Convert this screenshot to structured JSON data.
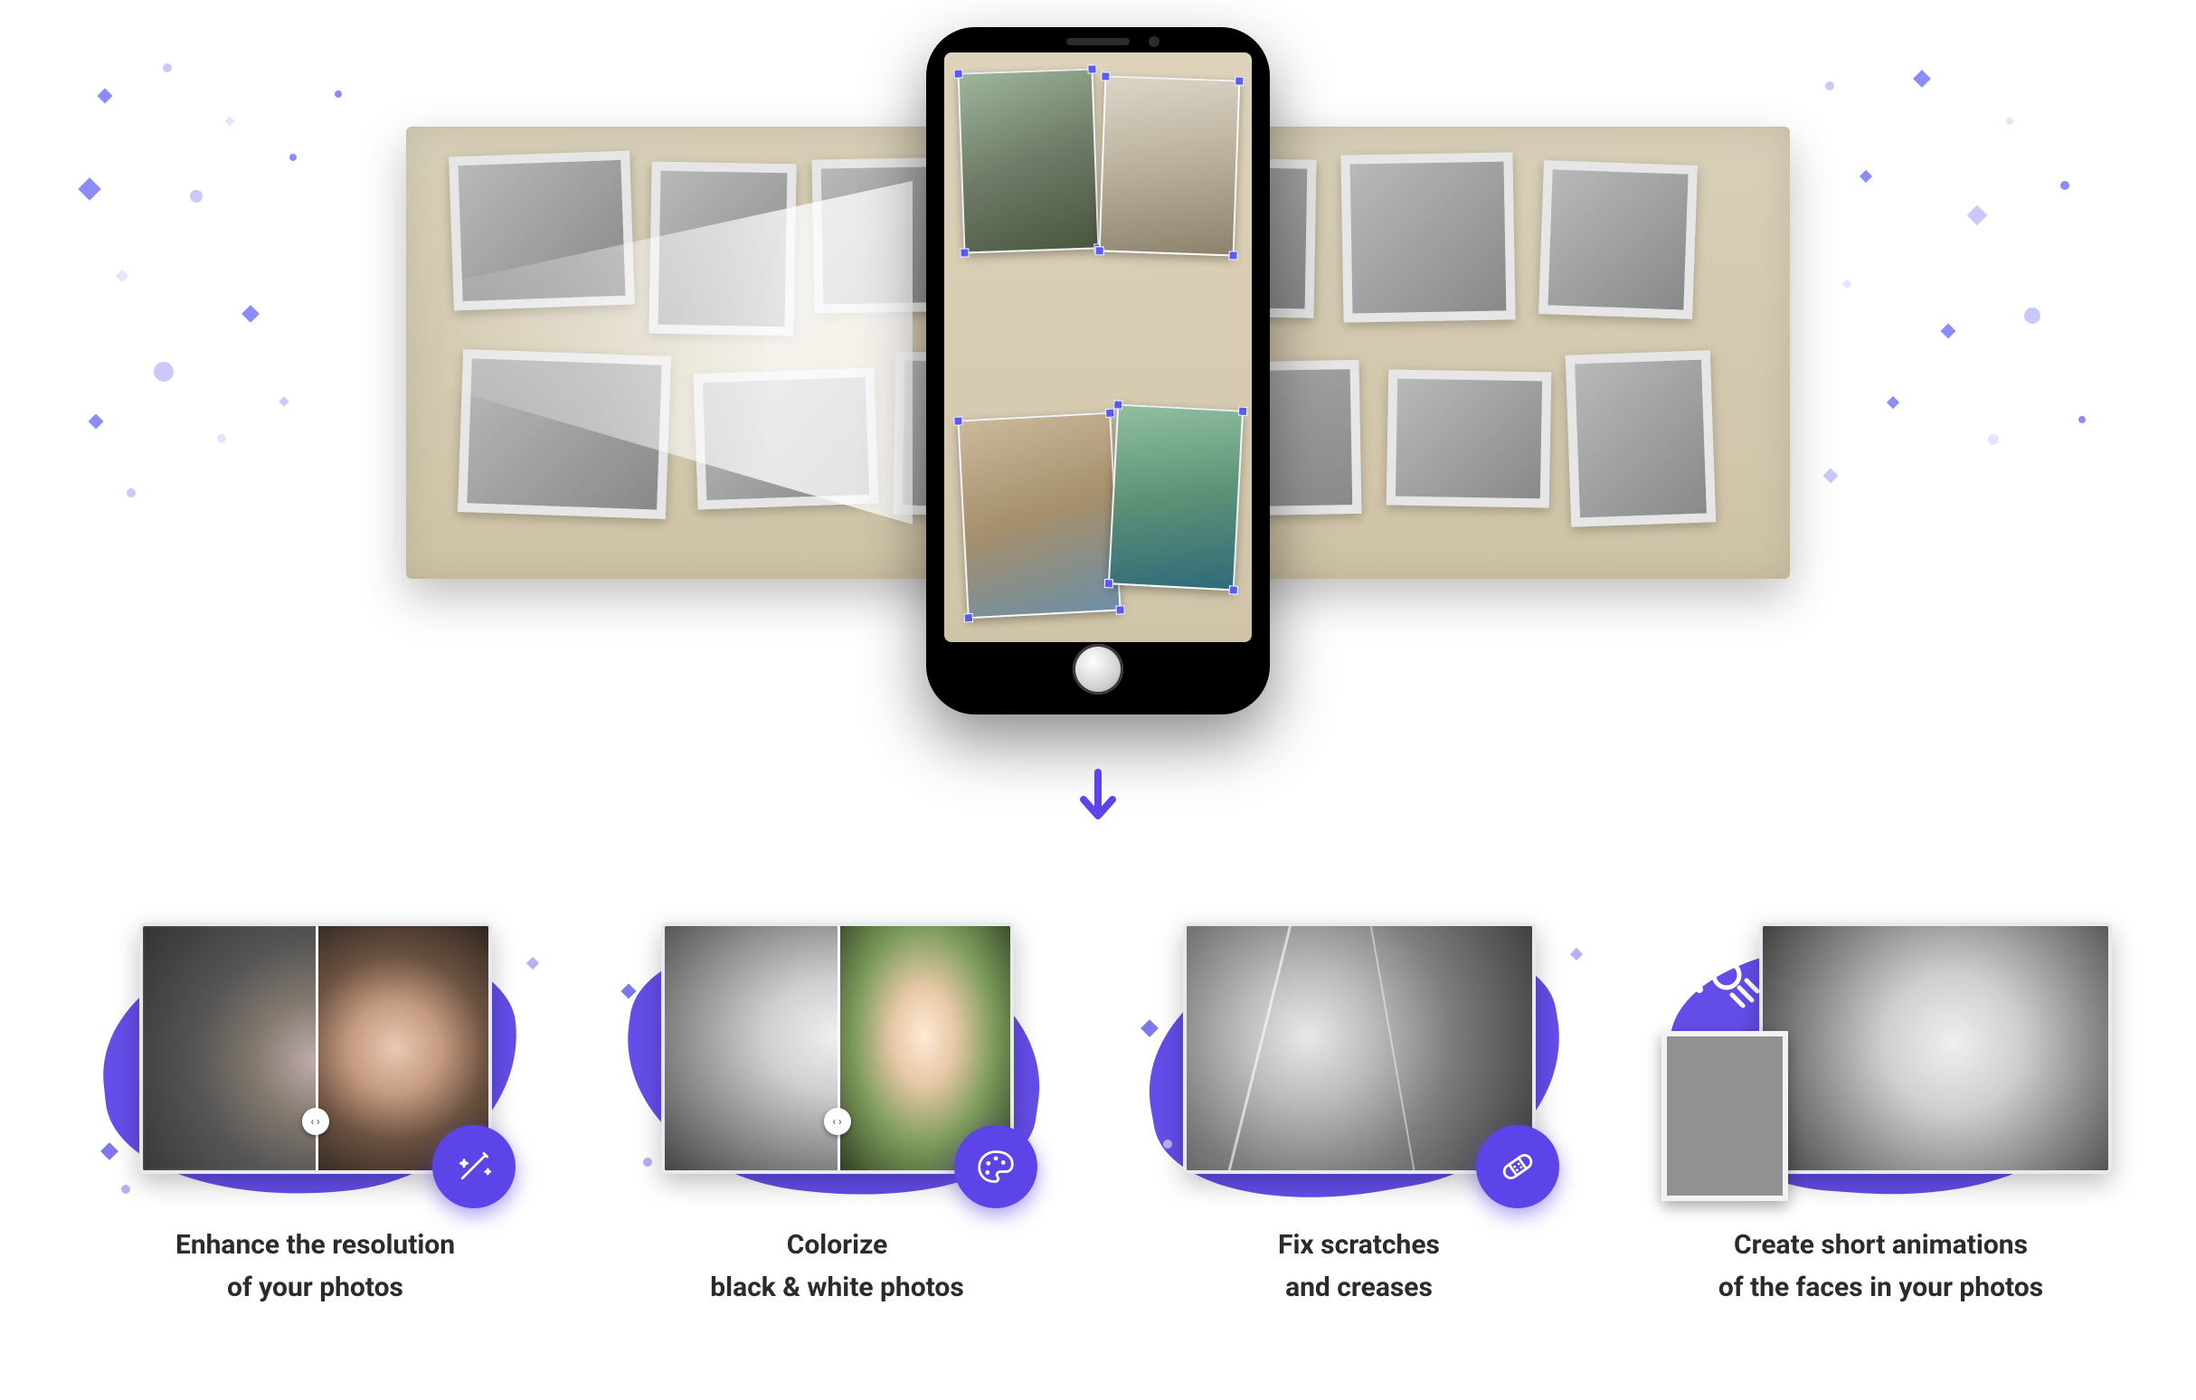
{
  "colors": {
    "accent": "#5b45e8"
  },
  "hero": {
    "arrow_icon": "arrow-down"
  },
  "features": [
    {
      "icon": "wand",
      "caption_line1": "Enhance the resolution",
      "caption_line2": "of your photos"
    },
    {
      "icon": "palette",
      "caption_line1": "Colorize",
      "caption_line2": "black & white photos"
    },
    {
      "icon": "bandage",
      "caption_line1": "Fix scratches",
      "caption_line2": "and creases"
    },
    {
      "icon": "animate",
      "caption_line1": "Create short animations",
      "caption_line2": "of the faces in your photos"
    }
  ]
}
